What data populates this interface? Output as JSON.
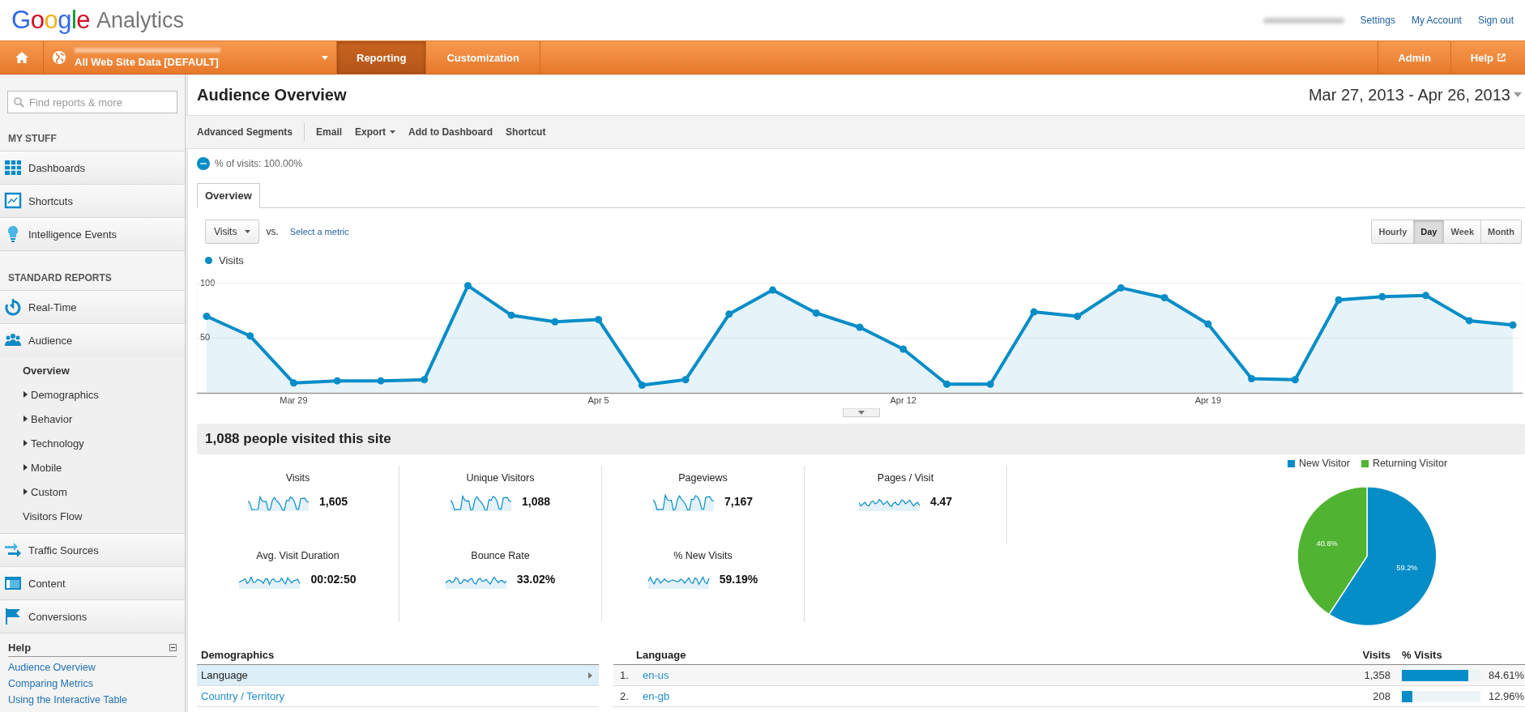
{
  "header": {
    "logo_google": "Google",
    "logo_product": "Analytics",
    "links": [
      "Settings",
      "My Account",
      "Sign out"
    ]
  },
  "nav": {
    "profile": "All Web Site Data [DEFAULT]",
    "tabs": [
      {
        "label": "Reporting",
        "selected": true
      },
      {
        "label": "Customization",
        "selected": false
      }
    ],
    "admin": "Admin",
    "help": "Help"
  },
  "sidebar": {
    "search": {
      "placeholder": "Find reports & more"
    },
    "sections": [
      {
        "title": "MY STUFF",
        "items": [
          {
            "label": "Dashboards"
          },
          {
            "label": "Shortcuts"
          },
          {
            "label": "Intelligence Events"
          }
        ]
      },
      {
        "title": "STANDARD REPORTS",
        "items": [
          {
            "label": "Real-Time"
          },
          {
            "label": "Audience",
            "expanded": true,
            "children": [
              {
                "label": "Overview",
                "selected": true
              },
              {
                "label": "Demographics",
                "selected": false,
                "expanded": false
              },
              {
                "label": "Behavior",
                "selected": false,
                "expanded": false
              },
              {
                "label": "Technology",
                "selected": false,
                "expanded": false
              },
              {
                "label": "Mobile",
                "selected": false,
                "expanded": false
              },
              {
                "label": "Custom",
                "selected": false,
                "expanded": false
              },
              {
                "label": "Visitors Flow",
                "selected": false
              }
            ]
          },
          {
            "label": "Traffic Sources"
          },
          {
            "label": "Content"
          },
          {
            "label": "Conversions"
          }
        ]
      }
    ],
    "help": {
      "title": "Help",
      "expanded": true,
      "links": [
        "Audience Overview",
        "Comparing Metrics",
        "Using the Interactive Table"
      ]
    }
  },
  "main": {
    "title": "Audience Overview",
    "date_range": "Mar 27, 2013 - Apr 26, 2013",
    "toolbar": [
      {
        "label": "Advanced Segments",
        "kind": "segment"
      },
      {
        "label": "Email",
        "kind": "plain"
      },
      {
        "label": "Export",
        "kind": "menu"
      },
      {
        "label": "Add to Dashboard",
        "kind": "plain"
      },
      {
        "label": "Shortcut",
        "kind": "plain"
      }
    ],
    "segment": "% of visits: 100.00%",
    "tabs": [
      {
        "label": "Overview",
        "selected": true
      }
    ],
    "metric_select": "Visits",
    "vs": "vs.",
    "compare_link": "Select a metric",
    "granularity": [
      {
        "label": "Hourly",
        "selected": false
      },
      {
        "label": "Day",
        "selected": true
      },
      {
        "label": "Week",
        "selected": false
      },
      {
        "label": "Month",
        "selected": false
      }
    ],
    "chart_data": {
      "type": "area",
      "ylim": [
        0,
        100
      ],
      "yticks": [
        50,
        100
      ],
      "categories": [
        null,
        null,
        "Mar 29",
        null,
        null,
        null,
        null,
        null,
        null,
        "Apr 5",
        null,
        null,
        null,
        null,
        null,
        null,
        "Apr 12",
        null,
        null,
        null,
        null,
        null,
        null,
        "Apr 19",
        null,
        null,
        null,
        null,
        null,
        null,
        null
      ],
      "series": [
        {
          "name": "Visits",
          "color": "#058dc7",
          "values": [
            70,
            52,
            9,
            11,
            11,
            12,
            98,
            71,
            65,
            67,
            7,
            12,
            72,
            94,
            73,
            60,
            40,
            8,
            8,
            74,
            70,
            96,
            87,
            63,
            13,
            12,
            85,
            88,
            89,
            66,
            62
          ]
        }
      ]
    },
    "summary_title": "1,088 people visited this site",
    "metrics": [
      {
        "label": "Visits",
        "value": "1,605"
      },
      {
        "label": "Unique Visitors",
        "value": "1,088"
      },
      {
        "label": "Pageviews",
        "value": "7,167"
      },
      {
        "label": "Pages / Visit",
        "value": "4.47"
      },
      {
        "label": "Avg. Visit Duration",
        "value": "00:02:50"
      },
      {
        "label": "Bounce Rate",
        "value": "33.02%"
      },
      {
        "label": "% New Visits",
        "value": "59.19%"
      }
    ],
    "pie": {
      "chart_data": {
        "type": "pie",
        "categories": [
          "New Visitor",
          "Returning Visitor"
        ],
        "data_labels": true,
        "value_labels": [
          "59.2%",
          "40.8%"
        ],
        "legend": "top",
        "values": [
          59.2,
          40.8
        ],
        "colors": [
          "#058dc7",
          "#50b432"
        ]
      }
    },
    "demographics": {
      "title": "Demographics",
      "items": [
        {
          "label": "Language",
          "selected": true
        },
        {
          "label": "Country / Territory",
          "selected": false
        }
      ]
    },
    "language_table": {
      "columns": [
        "Language",
        "Visits",
        "% Visits"
      ],
      "rows": [
        {
          "rank": "1.",
          "language": "en-us",
          "visits": "1,358",
          "percent": "84.61%",
          "level": 0.8461
        },
        {
          "rank": "2.",
          "language": "en-gb",
          "visits": "208",
          "percent": "12.96%",
          "level": 0.1296
        }
      ]
    }
  }
}
